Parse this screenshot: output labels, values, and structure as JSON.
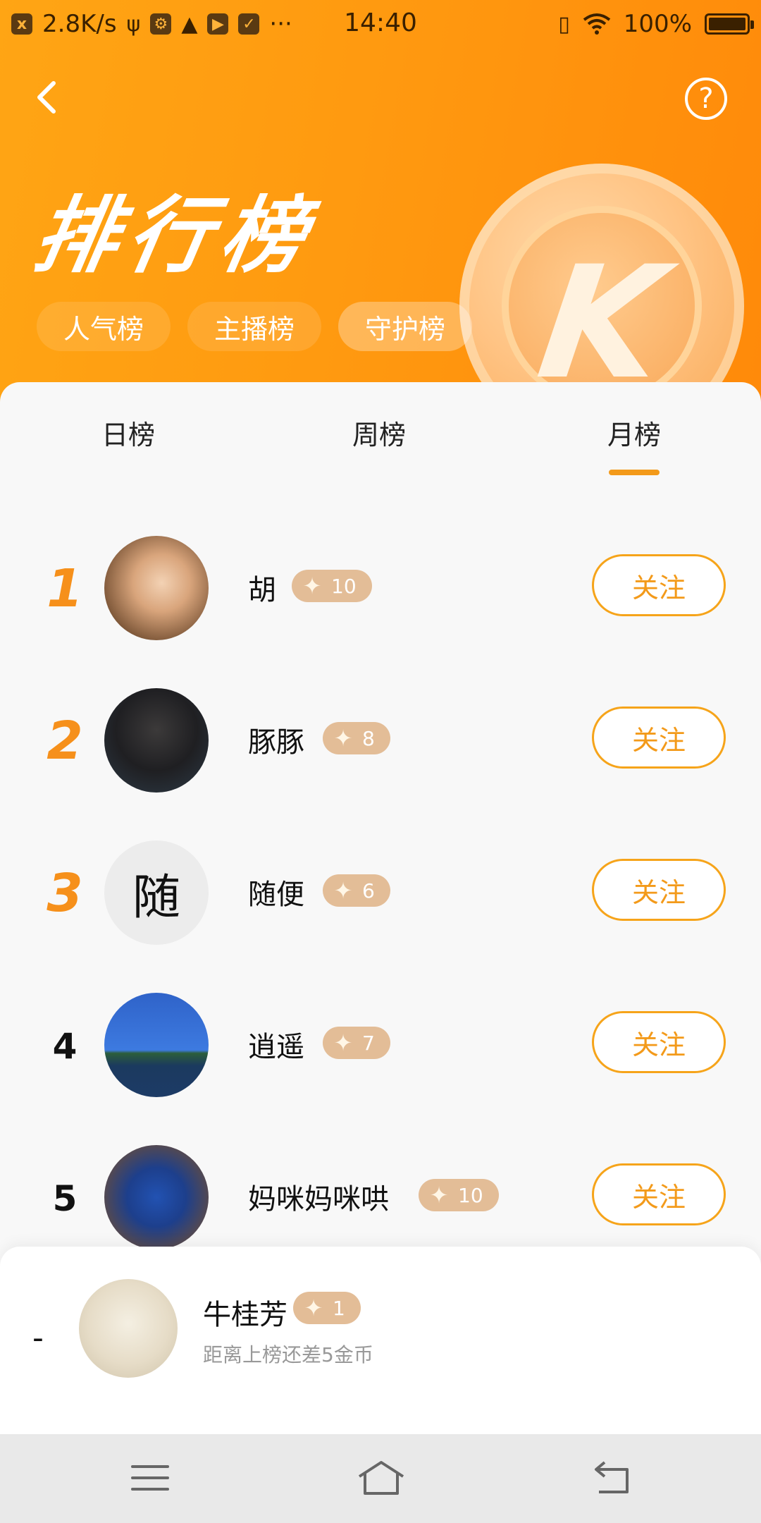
{
  "status_bar": {
    "speed": "2.8K/s",
    "dots": "···",
    "time": "14:40",
    "battery": "100%"
  },
  "header": {
    "title": "排行榜",
    "coin_letter": "K",
    "category_tabs": [
      "人气榜",
      "主播榜",
      "守护榜"
    ],
    "active_category": "守护榜"
  },
  "period_tabs": [
    "日榜",
    "周榜",
    "月榜"
  ],
  "active_period": "月榜",
  "ranking": [
    {
      "rank": "1",
      "name": "胡",
      "level": "10",
      "follow": "关注"
    },
    {
      "rank": "2",
      "name": "豚豚",
      "level": "8",
      "follow": "关注"
    },
    {
      "rank": "3",
      "name": "随便",
      "level": "6",
      "follow": "关注",
      "avatar_text": "随"
    },
    {
      "rank": "4",
      "name": "逍遥",
      "level": "7",
      "follow": "关注"
    },
    {
      "rank": "5",
      "name": "妈咪妈咪哄",
      "level": "10",
      "follow": "关注"
    }
  ],
  "me": {
    "rank": "-",
    "name": "牛桂芳",
    "level": "1",
    "hint": "距离上榜还差5金币"
  },
  "colors": {
    "accent": "#f39a1a",
    "header_bg": "#ffa514",
    "badge_bg": "#e3bd97"
  }
}
